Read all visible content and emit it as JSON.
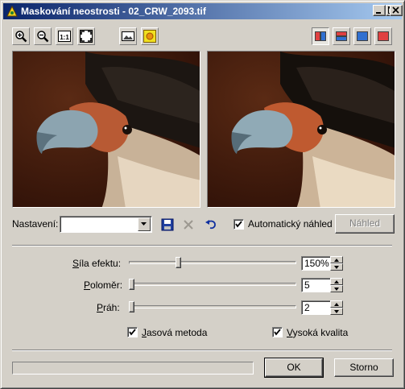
{
  "window": {
    "title": "Maskování neostrosti - 02_CRW_2093.tif",
    "title_icon": "app-icon"
  },
  "caption_buttons": [
    "minimize-icon",
    "maximize-icon",
    "close-icon"
  ],
  "toolbar": {
    "left": [
      "zoom-in-icon",
      "zoom-out-icon",
      "actual-size-icon",
      "fit-to-window-icon",
      "image-icon",
      "sun-icon"
    ],
    "view_modes": [
      "split-vertical-icon",
      "split-horizontal-icon",
      "single-view-blue-icon",
      "single-view-red-icon"
    ],
    "active_view_mode": "split-vertical-icon"
  },
  "preset": {
    "label": "Nastavení:",
    "value": "",
    "save_icon": "save-icon",
    "delete_icon": "delete-icon",
    "reset_icon": "undo-icon"
  },
  "auto_preview": {
    "label": "Automatický náhled",
    "checked": true
  },
  "preview_button": {
    "label": "Náhled",
    "enabled": false
  },
  "params": [
    {
      "label_access": "S",
      "label_rest": "íla efektu:",
      "value": "150%",
      "level": 0.29
    },
    {
      "label_access": "P",
      "label_rest": "oloměr:",
      "value": "5",
      "level": 0.0
    },
    {
      "label_access": "P",
      "label_rest": "ráh:",
      "value": "2",
      "level": 0.0
    }
  ],
  "options": {
    "luminance": {
      "label_access": "J",
      "label_rest": "asová metoda",
      "checked": true
    },
    "high_quality": {
      "label_access": "V",
      "label_rest": "ysoká kvalita",
      "checked": true
    }
  },
  "progress": {
    "value": 0
  },
  "buttons": {
    "ok": "OK",
    "cancel": "Storno"
  },
  "colors": {
    "titlebar_start": "#0a246a",
    "titlebar_end": "#a6caf0",
    "face": "#d4d0c8"
  }
}
